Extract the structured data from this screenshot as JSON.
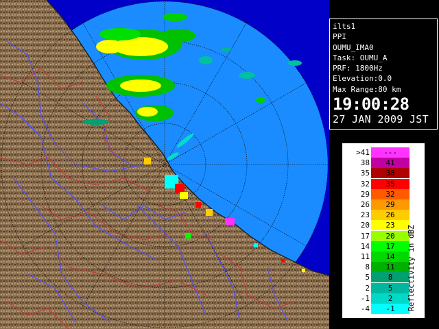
{
  "header": {
    "site": "ilts1",
    "product": "PPI",
    "volume": "OUMU_IMA0",
    "task": "Task: OUMU_A",
    "prf": "PRF: 1800Hz",
    "elevation": "Elevation:0.0",
    "max_range": "Max Range:80 km",
    "time": "19:00:28",
    "date": "27 JAN 2009 JST"
  },
  "legend": {
    "title": "Reflectivity in dBZ",
    "rows": [
      {
        "low": ">41",
        "high": "---",
        "color": "#ff33ff"
      },
      {
        "low": "38",
        "high": "41",
        "color": "#c000a0"
      },
      {
        "low": "35",
        "high": "38",
        "color": "#b00000"
      },
      {
        "low": "32",
        "high": "35",
        "color": "#ff0000"
      },
      {
        "low": "29",
        "high": "32",
        "color": "#ff5a00"
      },
      {
        "low": "26",
        "high": "29",
        "color": "#ff9900"
      },
      {
        "low": "23",
        "high": "26",
        "color": "#ffcc00"
      },
      {
        "low": "20",
        "high": "23",
        "color": "#ffff00"
      },
      {
        "low": "17",
        "high": "20",
        "color": "#99ff00"
      },
      {
        "low": "14",
        "high": "17",
        "color": "#00ff00"
      },
      {
        "low": "11",
        "high": "14",
        "color": "#00d800"
      },
      {
        "low": "8",
        "high": "11",
        "color": "#00b000"
      },
      {
        "low": "5",
        "high": "8",
        "color": "#00a070"
      },
      {
        "low": "2",
        "high": "5",
        "color": "#00b8a0"
      },
      {
        "low": "-1",
        "high": "2",
        "color": "#00d8c8"
      },
      {
        "low": "-4",
        "high": "-1",
        "color": "#00ffff"
      }
    ]
  },
  "map": {
    "sea_color": "#1a8cff",
    "far_sea_color": "#0000c8",
    "land_color": "#8a6e4e",
    "river_color": "#5050ff",
    "boundary_color": "#cc3333"
  }
}
